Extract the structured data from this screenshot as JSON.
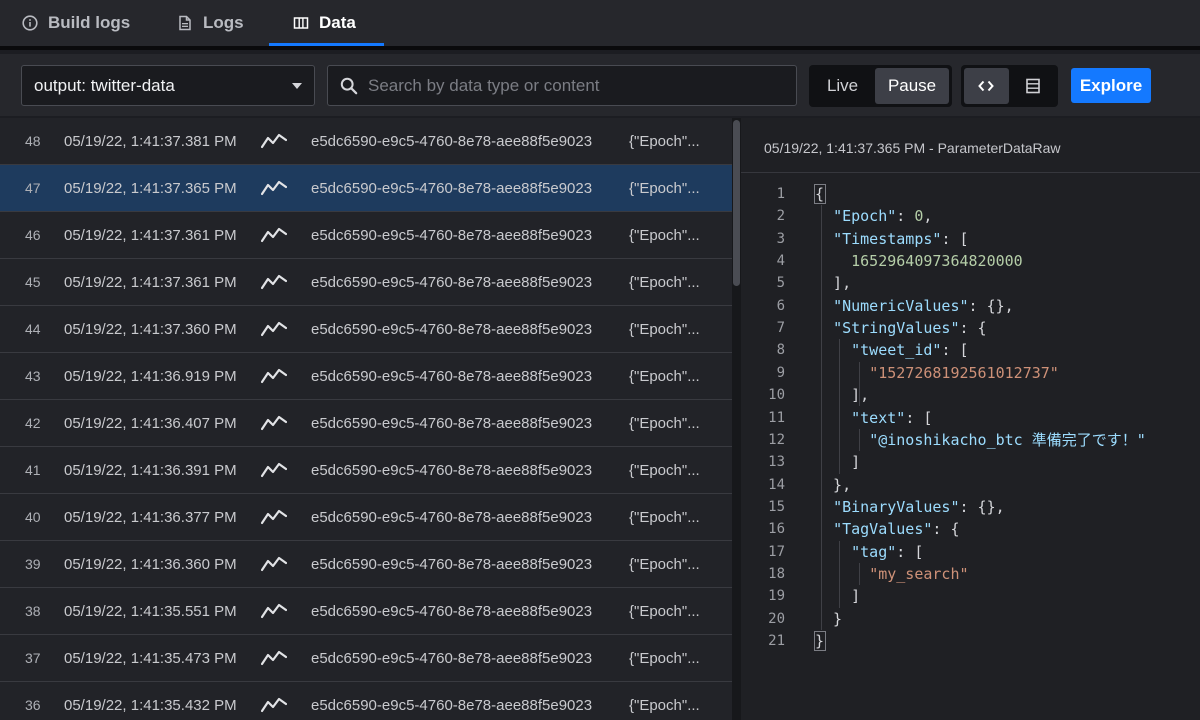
{
  "tabs": [
    {
      "label": "Build logs",
      "icon": "info-icon"
    },
    {
      "label": "Logs",
      "icon": "document-icon"
    },
    {
      "label": "Data",
      "icon": "columns-icon",
      "active": true
    }
  ],
  "toolbar": {
    "output_select": "output: twitter-data",
    "search_placeholder": "Search by data type or content",
    "live_label": "Live",
    "pause_label": "Pause",
    "explore_label": "Explore"
  },
  "rows": [
    {
      "num": "48",
      "time": "05/19/22, 1:41:37.381 PM",
      "id": "e5dc6590-e9c5-4760-8e78-aee88f5e9023",
      "value": "{\"Epoch\"..."
    },
    {
      "num": "47",
      "time": "05/19/22, 1:41:37.365 PM",
      "id": "e5dc6590-e9c5-4760-8e78-aee88f5e9023",
      "value": "{\"Epoch\"...",
      "selected": true
    },
    {
      "num": "46",
      "time": "05/19/22, 1:41:37.361 PM",
      "id": "e5dc6590-e9c5-4760-8e78-aee88f5e9023",
      "value": "{\"Epoch\"..."
    },
    {
      "num": "45",
      "time": "05/19/22, 1:41:37.361 PM",
      "id": "e5dc6590-e9c5-4760-8e78-aee88f5e9023",
      "value": "{\"Epoch\"..."
    },
    {
      "num": "44",
      "time": "05/19/22, 1:41:37.360 PM",
      "id": "e5dc6590-e9c5-4760-8e78-aee88f5e9023",
      "value": "{\"Epoch\"..."
    },
    {
      "num": "43",
      "time": "05/19/22, 1:41:36.919 PM",
      "id": "e5dc6590-e9c5-4760-8e78-aee88f5e9023",
      "value": "{\"Epoch\"..."
    },
    {
      "num": "42",
      "time": "05/19/22, 1:41:36.407 PM",
      "id": "e5dc6590-e9c5-4760-8e78-aee88f5e9023",
      "value": "{\"Epoch\"..."
    },
    {
      "num": "41",
      "time": "05/19/22, 1:41:36.391 PM",
      "id": "e5dc6590-e9c5-4760-8e78-aee88f5e9023",
      "value": "{\"Epoch\"..."
    },
    {
      "num": "40",
      "time": "05/19/22, 1:41:36.377 PM",
      "id": "e5dc6590-e9c5-4760-8e78-aee88f5e9023",
      "value": "{\"Epoch\"..."
    },
    {
      "num": "39",
      "time": "05/19/22, 1:41:36.360 PM",
      "id": "e5dc6590-e9c5-4760-8e78-aee88f5e9023",
      "value": "{\"Epoch\"..."
    },
    {
      "num": "38",
      "time": "05/19/22, 1:41:35.551 PM",
      "id": "e5dc6590-e9c5-4760-8e78-aee88f5e9023",
      "value": "{\"Epoch\"..."
    },
    {
      "num": "37",
      "time": "05/19/22, 1:41:35.473 PM",
      "id": "e5dc6590-e9c5-4760-8e78-aee88f5e9023",
      "value": "{\"Epoch\"..."
    },
    {
      "num": "36",
      "time": "05/19/22, 1:41:35.432 PM",
      "id": "e5dc6590-e9c5-4760-8e78-aee88f5e9023",
      "value": "{\"Epoch\"..."
    }
  ],
  "detail": {
    "title": "05/19/22, 1:41:37.365 PM - ParameterDataRaw",
    "lines": [
      [
        "{"
      ],
      [
        "  ",
        "k:\"Epoch\"",
        ": ",
        "n:0",
        ","
      ],
      [
        "  ",
        "k:\"Timestamps\"",
        ": ["
      ],
      [
        "    ",
        "n:1652964097364820000"
      ],
      [
        "  ],"
      ],
      [
        "  ",
        "k:\"NumericValues\"",
        ": {},"
      ],
      [
        "  ",
        "k:\"StringValues\"",
        ": {"
      ],
      [
        "    ",
        "k:\"tweet_id\"",
        ": ["
      ],
      [
        "      ",
        "s:\"1527268192561012737\""
      ],
      [
        "    ],"
      ],
      [
        "    ",
        "k:\"text\"",
        ": ["
      ],
      [
        "      ",
        "sj:\"@inoshikacho_btc 準備完了です！\""
      ],
      [
        "    ]"
      ],
      [
        "  },"
      ],
      [
        "  ",
        "k:\"BinaryValues\"",
        ": {},"
      ],
      [
        "  ",
        "k:\"TagValues\"",
        ": {"
      ],
      [
        "    ",
        "k:\"tag\"",
        ": ["
      ],
      [
        "      ",
        "s:\"my_search\""
      ],
      [
        "    ]"
      ],
      [
        "  }"
      ],
      [
        "}"
      ]
    ]
  }
}
